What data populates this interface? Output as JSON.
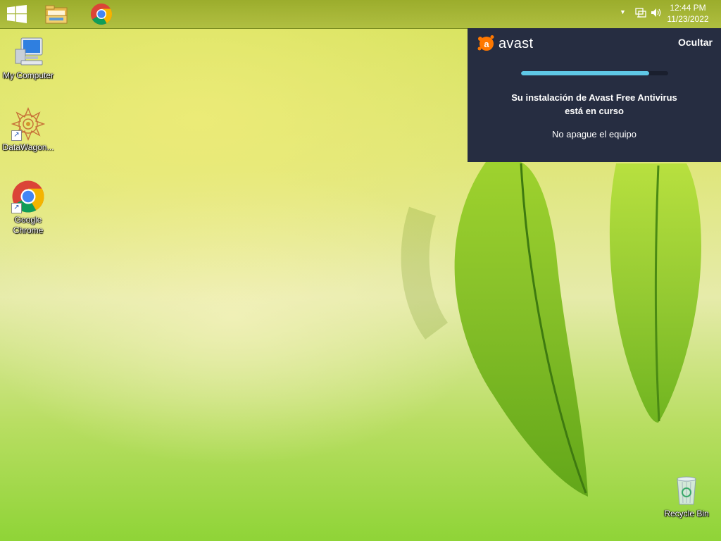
{
  "taskbar": {
    "start_icon": "windows-logo-icon",
    "pinned": [
      {
        "name": "file-explorer",
        "icon": "folder-icon"
      },
      {
        "name": "google-chrome",
        "icon": "chrome-icon"
      }
    ],
    "tray": {
      "icons": [
        "chevron-up-icon",
        "network-icon",
        "volume-icon"
      ],
      "time": "12:44 PM",
      "date": "11/23/2022"
    }
  },
  "desktop": {
    "icons": [
      {
        "label": "My Computer",
        "icon": "computer-icon"
      },
      {
        "label": "DataWagon...",
        "icon": "datawagon-icon"
      },
      {
        "label_line1": "Google",
        "label_line2": "Chrome",
        "icon": "chrome-icon"
      },
      {
        "label": "Recycle Bin",
        "icon": "recycle-bin-icon"
      }
    ]
  },
  "avast": {
    "brand": "avast",
    "hide_label": "Ocultar",
    "progress": 0.87,
    "message_line1": "Su instalación de Avast Free Antivirus",
    "message_line2": "está en curso",
    "sub_message": "No apague el equipo",
    "colors": {
      "panel": "#262d41",
      "accent": "#ff7800",
      "progress": "#5fc8e6"
    }
  }
}
